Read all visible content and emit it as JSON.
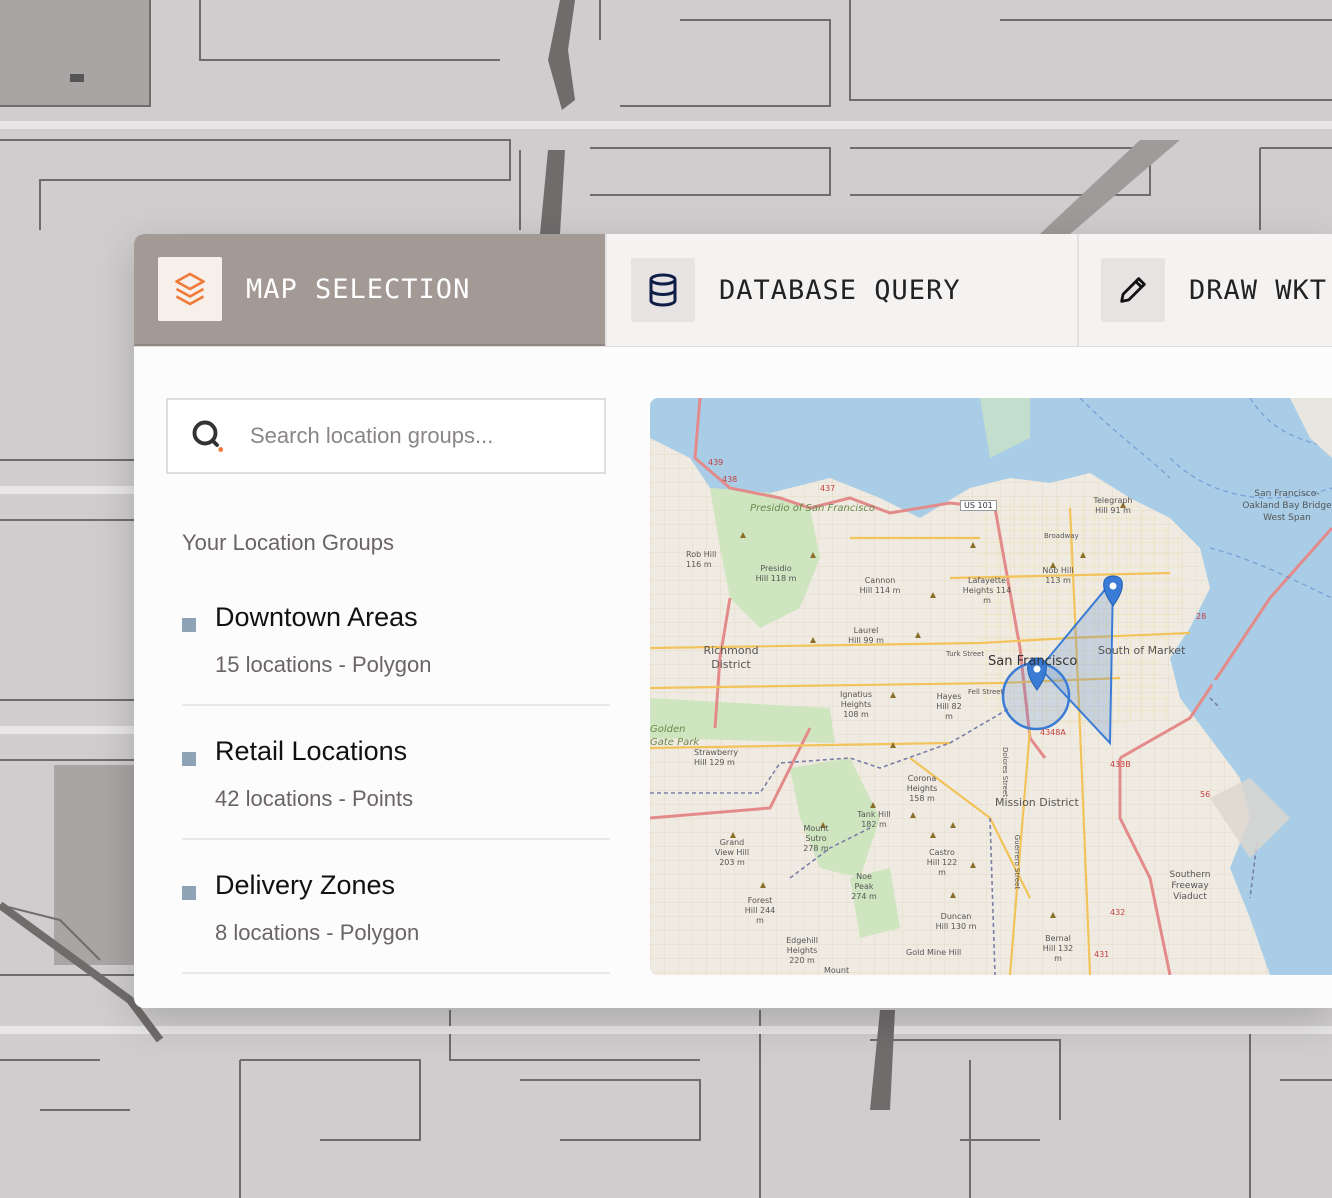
{
  "tabs": [
    {
      "label": "MAP SELECTION",
      "icon": "layers-icon",
      "active": true
    },
    {
      "label": "DATABASE QUERY",
      "icon": "database-icon",
      "active": false
    },
    {
      "label": "DRAW WKT",
      "icon": "pencil-icon",
      "active": false
    }
  ],
  "search": {
    "placeholder": "Search location groups...",
    "icon": "search-icon"
  },
  "groups_title": "Your Location Groups",
  "groups": [
    {
      "name": "Downtown Areas",
      "meta": "15 locations - Polygon"
    },
    {
      "name": "Retail Locations",
      "meta": "42 locations - Points"
    },
    {
      "name": "Delivery Zones",
      "meta": "8 locations - Polygon"
    }
  ],
  "map": {
    "labels": {
      "presidio": "Presidio of San Francisco",
      "richmond": "Richmond District",
      "golden_gate": "Golden Gate Park",
      "san_francisco": "San Francisco",
      "south_of_market": "South of Market",
      "mission": "Mission District",
      "bay_bridge": "San Francisco-Oakland Bay Bridge West Span",
      "telegraph": "Telegraph Hill 91 m",
      "nob_hill": "Nob Hill 113 m",
      "lafayette": "Lafayette Heights 114 m",
      "cannon": "Cannon Hill 114 m",
      "rob_hill": "Rob Hill 116 m",
      "presidio_hill": "Presidio Hill 118 m",
      "laurel": "Laurel Hill 99 m",
      "ignatius": "Ignatius Heights 108 m",
      "hayes": "Hayes Hill 82 m",
      "strawberry": "Strawberry Hill 129 m",
      "corona": "Corona Heights 158 m",
      "tank": "Tank Hill 182 m",
      "sutro": "Mount Sutro 278 m",
      "grand_view": "Grand View Hill 203 m",
      "noe": "Noe Peak 274 m",
      "castro": "Castro Hill 122 m",
      "forest": "Forest Hill 244 m",
      "edgehill": "Edgehill Heights 220 m",
      "duncan": "Duncan Hill 130 m",
      "gold_mine": "Gold Mine Hill",
      "bernal": "Bernal Hill 132 m",
      "southern_freeway": "Southern Freeway Viaduct",
      "us101": "US 101",
      "broadway": "Broadway",
      "turk": "Turk Street",
      "fell": "Fell Street",
      "dolores": "Dolores Street",
      "guerrero": "Guerrero Street",
      "r439": "439",
      "r438": "438",
      "r437": "437",
      "r4348a": "4348A",
      "r433b": "433B",
      "r432": "432",
      "r431": "431",
      "r56": "56",
      "r28": "28",
      "mount": "Mount"
    },
    "colors": {
      "water": "#a9cde6",
      "land": "#f0ebe2",
      "park": "#cfe5c0",
      "highway": "#e38b8b",
      "selection": "#3a7bd5"
    }
  },
  "colors": {
    "accent": "#f07a3a",
    "tab_active_bg": "#a39a95",
    "bullet": "#8fa3b6"
  }
}
